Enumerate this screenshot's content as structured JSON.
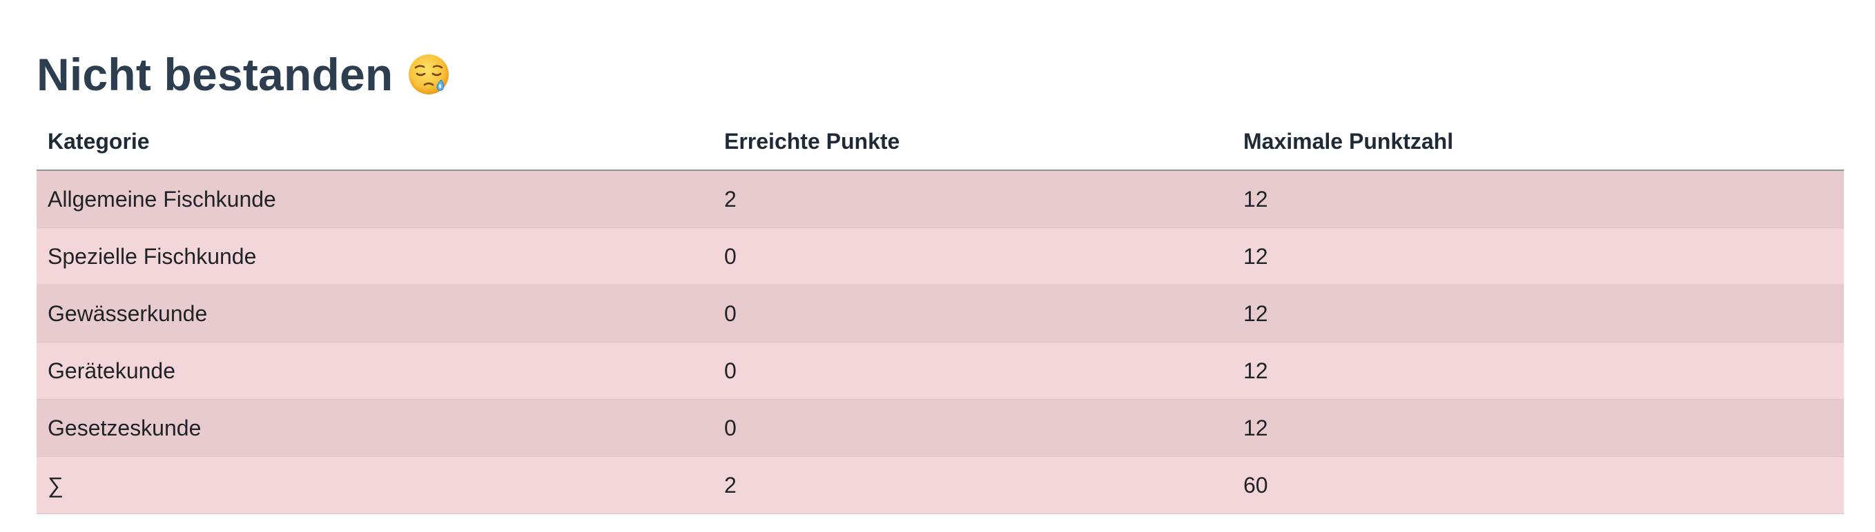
{
  "page": {
    "title": "Nicht bestanden",
    "title_emoji": "sleepy-face-icon"
  },
  "table": {
    "headers": [
      "Kategorie",
      "Erreichte Punkte",
      "Maximale Punktzahl"
    ],
    "rows": [
      {
        "category": "Allgemeine Fischkunde",
        "achieved": "2",
        "max": "12"
      },
      {
        "category": "Spezielle Fischkunde",
        "achieved": "0",
        "max": "12"
      },
      {
        "category": "Gewässerkunde",
        "achieved": "0",
        "max": "12"
      },
      {
        "category": "Gerätekunde",
        "achieved": "0",
        "max": "12"
      },
      {
        "category": "Gesetzeskunde",
        "achieved": "0",
        "max": "12"
      },
      {
        "category": "∑",
        "achieved": "2",
        "max": "60"
      }
    ]
  },
  "colors": {
    "title": "#2c3e50",
    "row_odd": "#e8cbcf",
    "row_even": "#f2d6d9",
    "header_border": "#8a9497"
  }
}
